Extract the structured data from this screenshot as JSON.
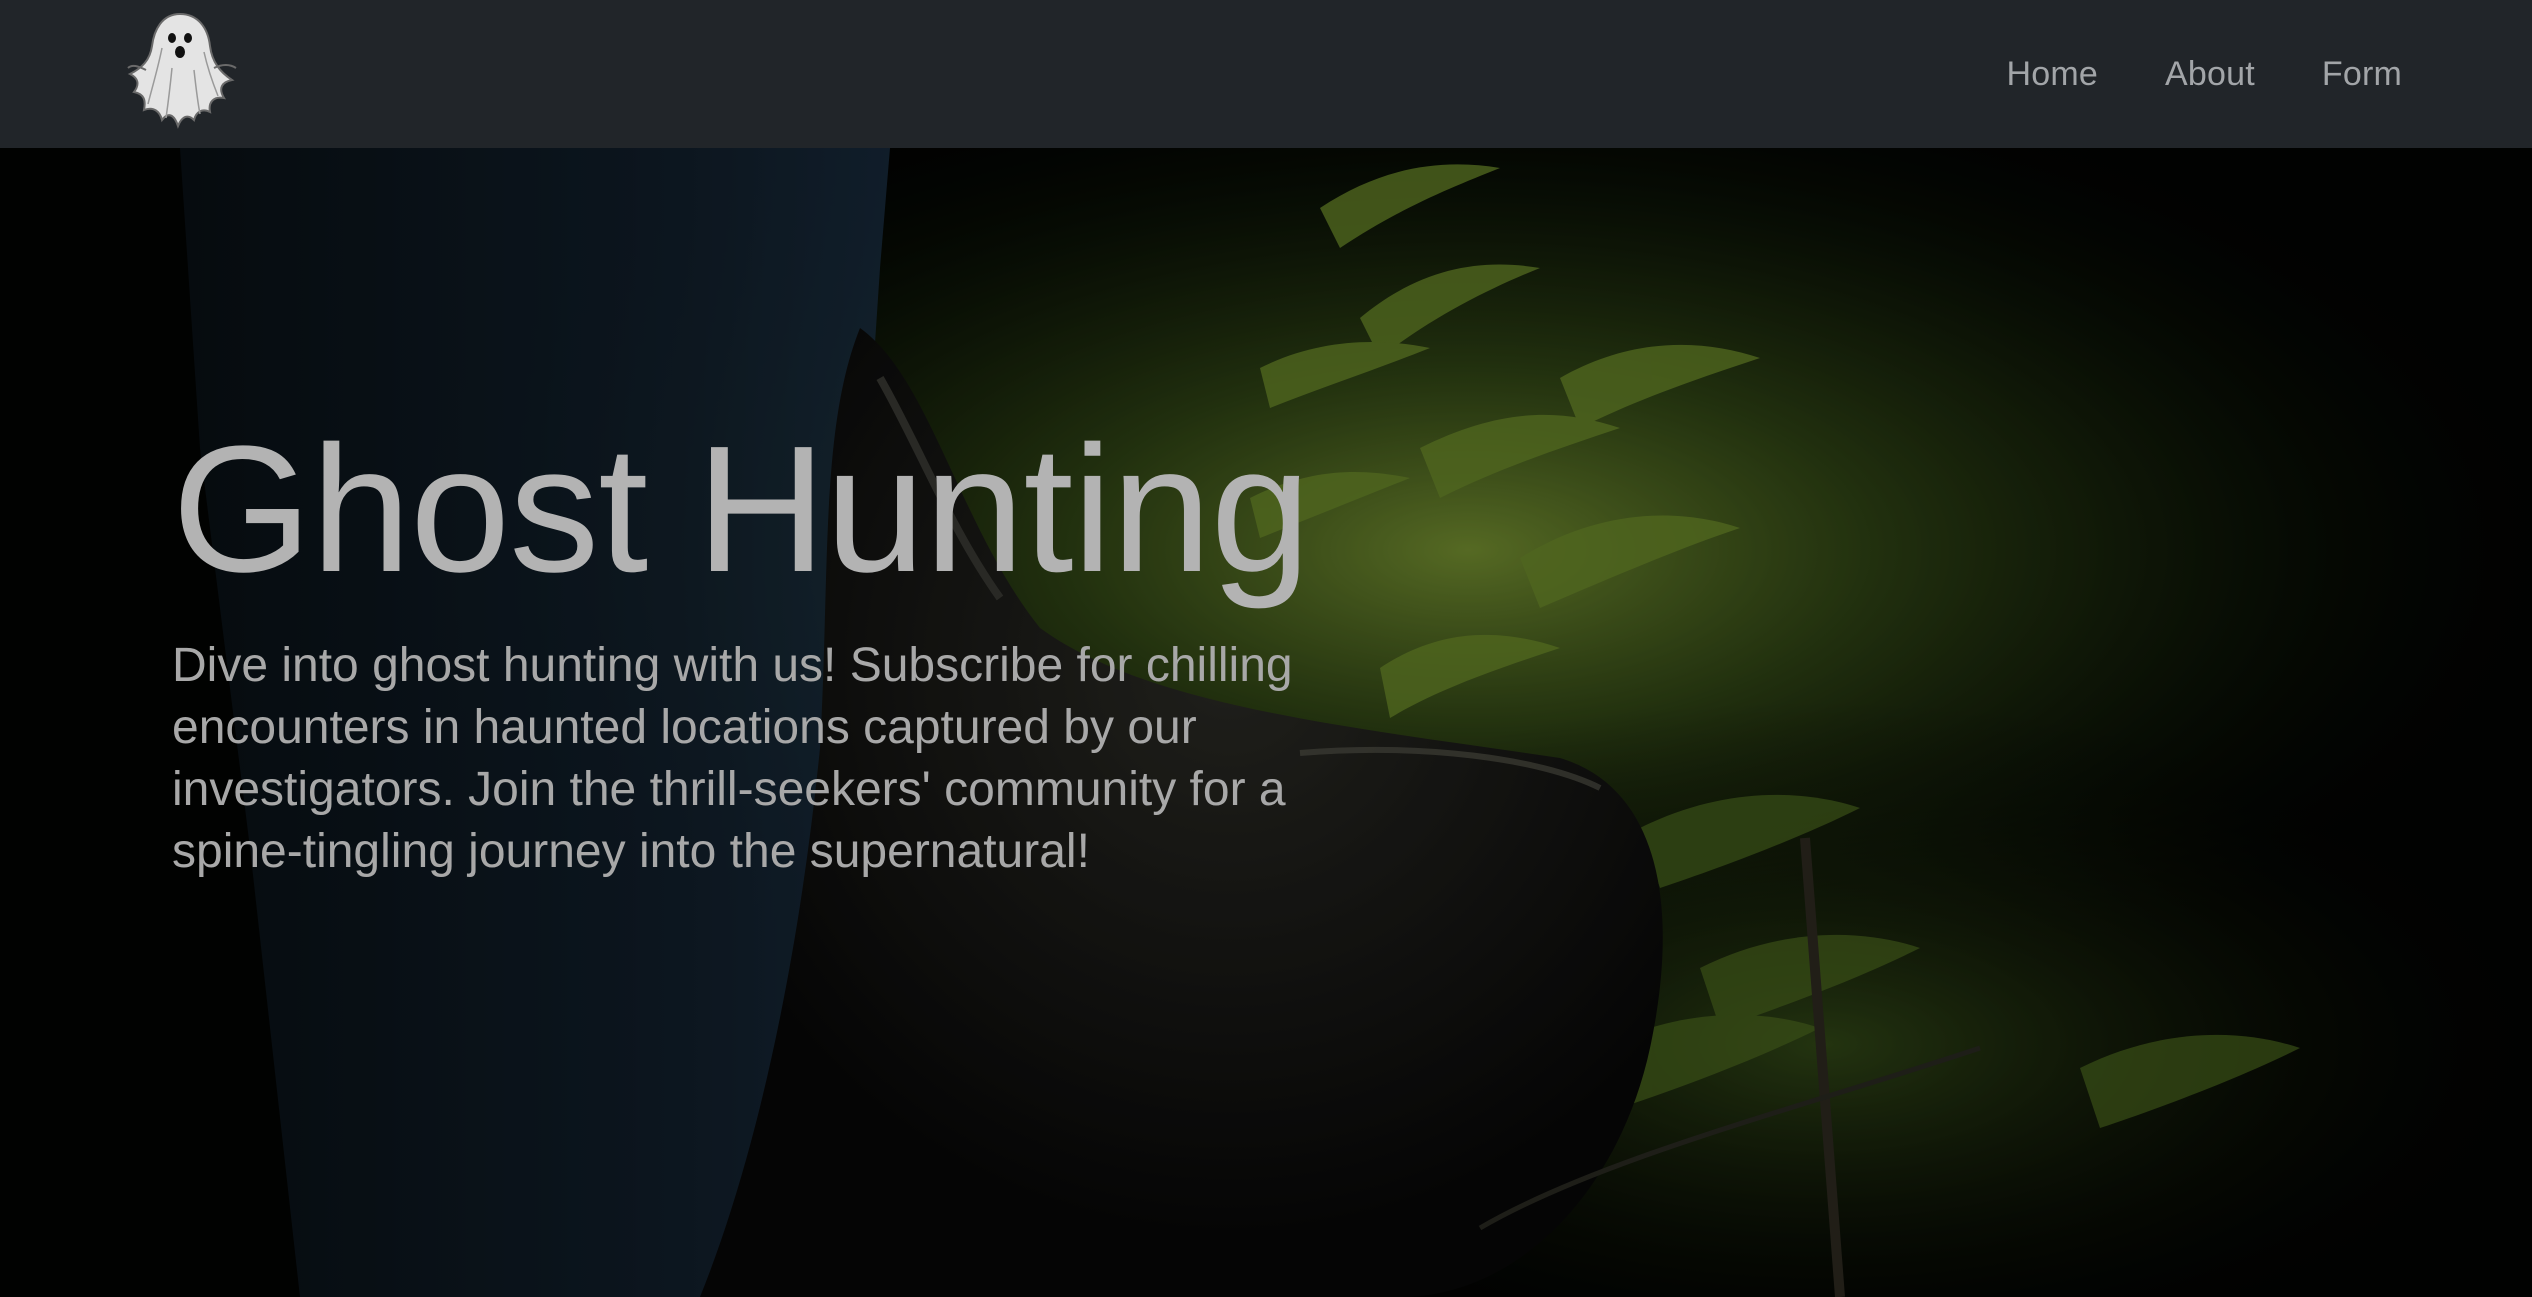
{
  "navbar": {
    "logo_icon": "ghost-logo-icon",
    "links": [
      {
        "label": "Home"
      },
      {
        "label": "About"
      },
      {
        "label": "Form"
      }
    ]
  },
  "hero": {
    "title": "Ghost Hunting",
    "description": "Dive into ghost hunting with us! Subscribe for chilling encounters in haunted locations captured by our investigators. Join the thrill-seekers' community for a spine-tingling journey into the supernatural!",
    "background": "night-forest-ferns-boots-photo"
  },
  "colors": {
    "navbar_bg": "#212529",
    "nav_link": "#a2a5a8",
    "title_text": "#b3b3b3",
    "body_text": "#a8a8a8",
    "fern_green": "#6f8f2a"
  }
}
